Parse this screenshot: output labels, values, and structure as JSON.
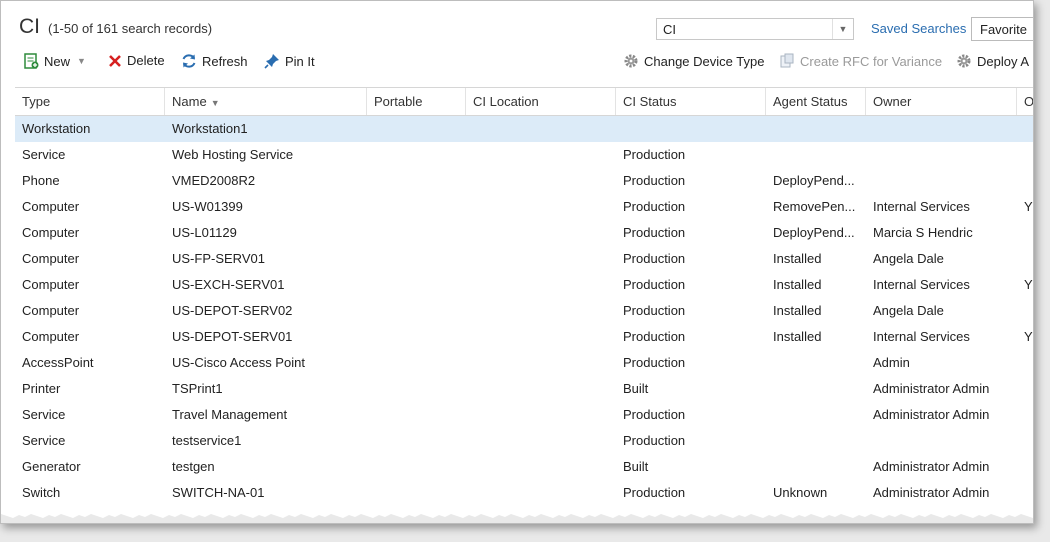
{
  "header": {
    "title": "CI",
    "count": "(1-50 of 161 search records)",
    "search_value": "CI",
    "saved_searches": "Saved Searches",
    "favorites": "Favorite"
  },
  "toolbar": {
    "new": "New",
    "delete": "Delete",
    "refresh": "Refresh",
    "pin": "Pin It",
    "change_device": "Change Device Type",
    "create_rfc": "Create RFC for Variance",
    "deploy": "Deploy A"
  },
  "columns": [
    "Type",
    "Name",
    "Portable",
    "CI Location",
    "CI Status",
    "Agent Status",
    "Owner",
    "O"
  ],
  "rows": [
    {
      "type": "Workstation",
      "name": "Workstation1",
      "status": "",
      "agent": "",
      "owner": "",
      "extra": ""
    },
    {
      "type": "Service",
      "name": "Web Hosting Service",
      "status": "Production",
      "agent": "",
      "owner": "",
      "extra": ""
    },
    {
      "type": "Phone",
      "name": "VMED2008R2",
      "status": "Production",
      "agent": "DeployPend...",
      "owner": "",
      "extra": ""
    },
    {
      "type": "Computer",
      "name": "US-W01399",
      "status": "Production",
      "agent": "RemovePen...",
      "owner": "Internal Services",
      "extra": "Y"
    },
    {
      "type": "Computer",
      "name": "US-L01129",
      "status": "Production",
      "agent": "DeployPend...",
      "owner": "Marcia S Hendric",
      "extra": ""
    },
    {
      "type": "Computer",
      "name": "US-FP-SERV01",
      "status": "Production",
      "agent": "Installed",
      "owner": "Angela Dale",
      "extra": ""
    },
    {
      "type": "Computer",
      "name": "US-EXCH-SERV01",
      "status": "Production",
      "agent": "Installed",
      "owner": "Internal Services",
      "extra": "Y"
    },
    {
      "type": "Computer",
      "name": "US-DEPOT-SERV02",
      "status": "Production",
      "agent": "Installed",
      "owner": "Angela Dale",
      "extra": ""
    },
    {
      "type": "Computer",
      "name": "US-DEPOT-SERV01",
      "status": "Production",
      "agent": "Installed",
      "owner": "Internal Services",
      "extra": "Y"
    },
    {
      "type": "AccessPoint",
      "name": "US-Cisco Access Point",
      "status": "Production",
      "agent": "",
      "owner": "Admin",
      "extra": ""
    },
    {
      "type": "Printer",
      "name": "TSPrint1",
      "status": "Built",
      "agent": "",
      "owner": "Administrator Admin",
      "extra": ""
    },
    {
      "type": "Service",
      "name": "Travel Management",
      "status": "Production",
      "agent": "",
      "owner": "Administrator Admin",
      "extra": ""
    },
    {
      "type": "Service",
      "name": "testservice1",
      "status": "Production",
      "agent": "",
      "owner": "",
      "extra": ""
    },
    {
      "type": "Generator",
      "name": "testgen",
      "status": "Built",
      "agent": "",
      "owner": "Administrator Admin",
      "extra": ""
    },
    {
      "type": "Switch",
      "name": "SWITCH-NA-01",
      "status": "Production",
      "agent": "Unknown",
      "owner": "Administrator Admin",
      "extra": ""
    }
  ]
}
